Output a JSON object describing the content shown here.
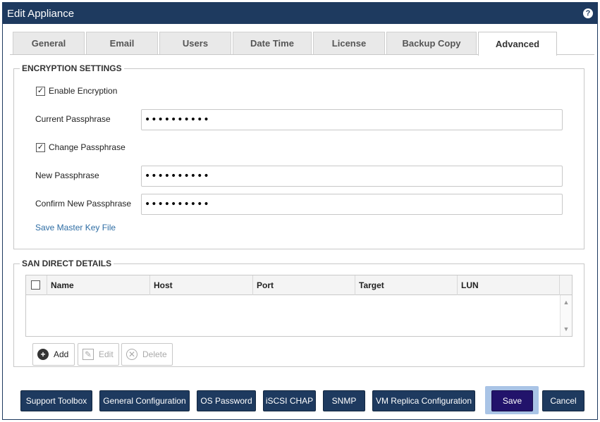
{
  "window": {
    "title": "Edit Appliance",
    "help_icon": "?"
  },
  "tabs": [
    {
      "label": "General"
    },
    {
      "label": "Email"
    },
    {
      "label": "Users"
    },
    {
      "label": "Date Time"
    },
    {
      "label": "License"
    },
    {
      "label": "Backup Copy"
    },
    {
      "label": "Advanced",
      "active": true
    }
  ],
  "encryption": {
    "legend": "ENCRYPTION SETTINGS",
    "enable_label": "Enable Encryption",
    "enable_checked": true,
    "current_label": "Current Passphrase",
    "current_value": "••••••••••",
    "change_label": "Change Passphrase",
    "change_checked": true,
    "new_label": "New Passphrase",
    "new_value": "••••••••••",
    "confirm_label": "Confirm New Passphrase",
    "confirm_value": "••••••••••",
    "save_key_link": "Save Master Key File"
  },
  "san": {
    "legend": "SAN DIRECT DETAILS",
    "columns": [
      "Name",
      "Host",
      "Port",
      "Target",
      "LUN"
    ],
    "rows": [],
    "add_label": "Add",
    "edit_label": "Edit",
    "delete_label": "Delete"
  },
  "footer": {
    "support_toolbox": "Support Toolbox",
    "general_configuration": "General Configuration",
    "os_password": "OS Password",
    "iscsi_chap": "iSCSI CHAP",
    "snmp": "SNMP",
    "vm_replica": "VM Replica Configuration",
    "save": "Save",
    "cancel": "Cancel"
  },
  "colors": {
    "primary": "#1e3a5f",
    "save": "#22136b",
    "link": "#2e6da4"
  }
}
